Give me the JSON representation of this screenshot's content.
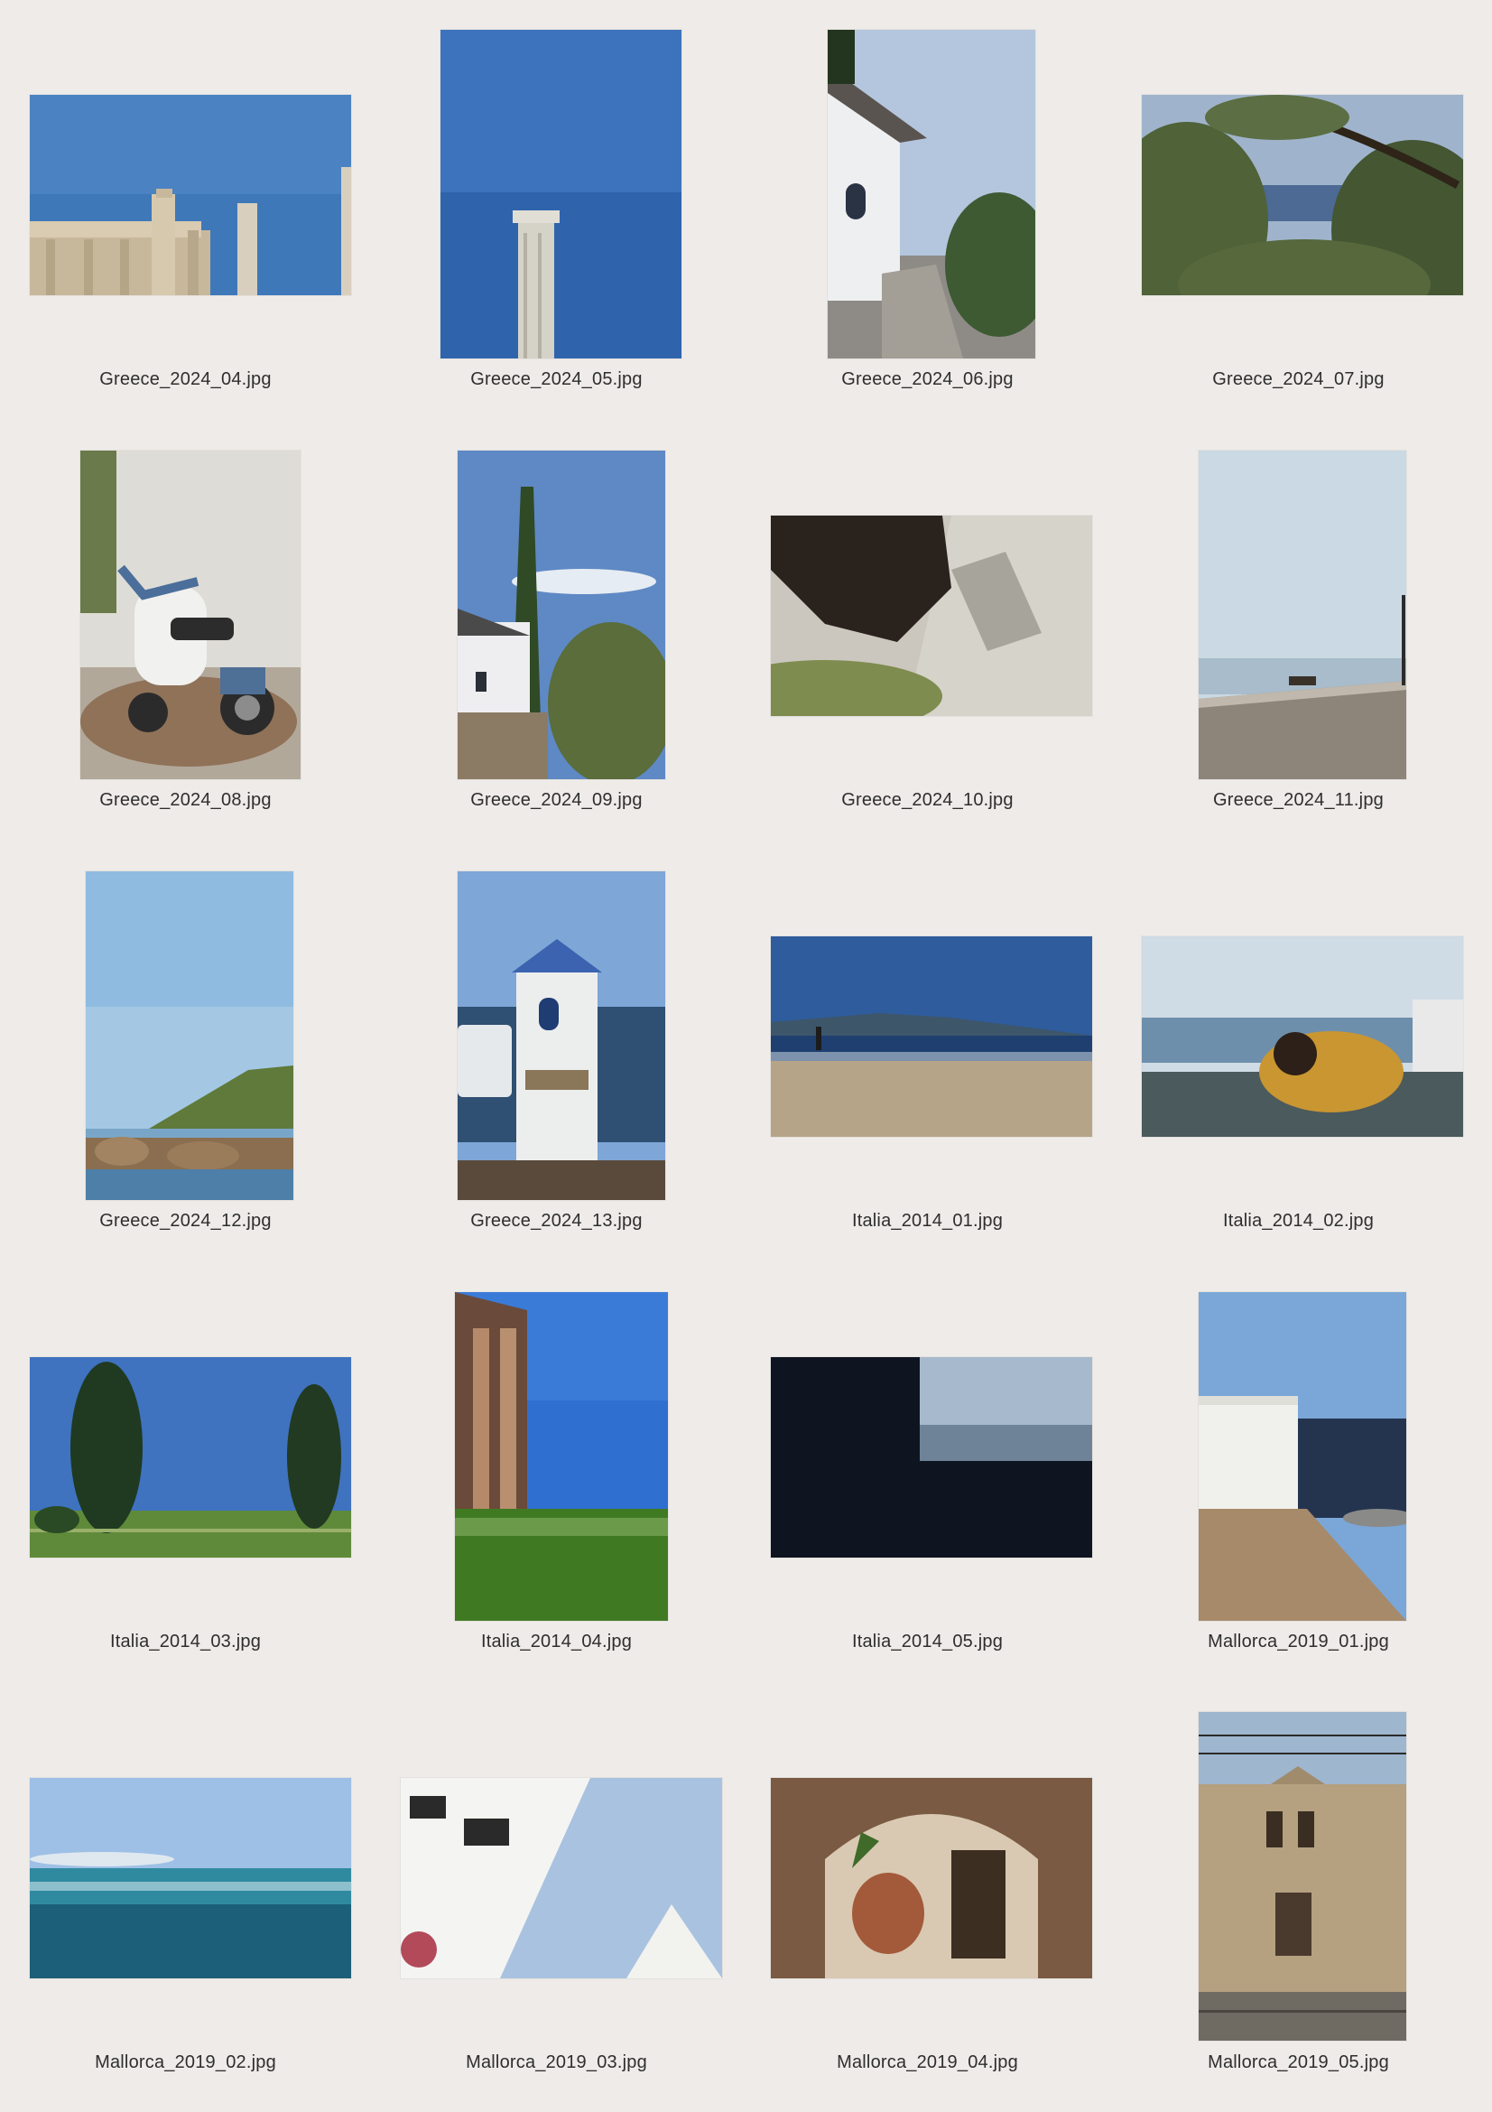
{
  "photos": [
    {
      "label": "Greece_2024_04.jpg",
      "icon": "ruins-columns-photo",
      "palette": [
        "#4f86c4",
        "#2f6cb5",
        "#d8cbb3",
        "#b8a98c"
      ]
    },
    {
      "label": "Greece_2024_05.jpg",
      "icon": "single-column-photo",
      "palette": [
        "#3e73bd",
        "#2c5fa8",
        "#d9d6cc",
        "#b9b4a7"
      ]
    },
    {
      "label": "Greece_2024_06.jpg",
      "icon": "white-chapel-photo",
      "palette": [
        "#a9bfdc",
        "#eef0f2",
        "#8c8a86",
        "#3f5c36"
      ]
    },
    {
      "label": "Greece_2024_07.jpg",
      "icon": "olive-trees-sea-photo",
      "palette": [
        "#a7b9cf",
        "#4a678f",
        "#485a36",
        "#2e3a22"
      ]
    },
    {
      "label": "Greece_2024_08.jpg",
      "icon": "scooter-photo",
      "palette": [
        "#e4e3de",
        "#c9c6bf",
        "#4a6d96",
        "#8a6f55"
      ]
    },
    {
      "label": "Greece_2024_09.jpg",
      "icon": "cypress-house-photo",
      "palette": [
        "#5d89c4",
        "#e9e9ec",
        "#2d4a22",
        "#8a7a64"
      ]
    },
    {
      "label": "Greece_2024_10.jpg",
      "icon": "foot-shadow-photo",
      "palette": [
        "#c9c5bc",
        "#2b2520",
        "#7a8a4c",
        "#a9a59c"
      ]
    },
    {
      "label": "Greece_2024_11.jpg",
      "icon": "bench-seafront-photo",
      "palette": [
        "#c8d8e2",
        "#9fb6c8",
        "#8c8378",
        "#2b2b2b"
      ]
    },
    {
      "label": "Greece_2024_12.jpg",
      "icon": "bay-hill-photo",
      "palette": [
        "#9ec3e2",
        "#6fa2d0",
        "#5f7a3a",
        "#8a6e4f"
      ]
    },
    {
      "label": "Greece_2024_13.jpg",
      "icon": "roadside-shrine-photo",
      "palette": [
        "#7ea6d6",
        "#f0f0ef",
        "#2f4f73",
        "#5a4a3c"
      ]
    },
    {
      "label": "Italia_2014_01.jpg",
      "icon": "beach-walker-photo",
      "palette": [
        "#345f9d",
        "#1f3f71",
        "#b8a58a",
        "#9b8a72"
      ]
    },
    {
      "label": "Italia_2014_02.jpg",
      "icon": "harbor-view-photo",
      "palette": [
        "#cdd9e4",
        "#6d8fac",
        "#c9922e",
        "#4b5a5c"
      ]
    },
    {
      "label": "Italia_2014_03.jpg",
      "icon": "twin-cypress-photo",
      "palette": [
        "#3f72bf",
        "#1f3a21",
        "#5f8a3a",
        "#98b06a"
      ]
    },
    {
      "label": "Italia_2014_04.jpg",
      "icon": "temple-columns-photo",
      "palette": [
        "#2f6fd0",
        "#b58a6a",
        "#3f7a22",
        "#6a4a3a"
      ]
    },
    {
      "label": "Italia_2014_05.jpg",
      "icon": "window-sea-photo",
      "palette": [
        "#0e1520",
        "#a7b9cc",
        "#6e8398",
        "#24354a"
      ]
    },
    {
      "label": "Mallorca_2019_01.jpg",
      "icon": "white-wall-sea-photo",
      "palette": [
        "#79a6d6",
        "#f0f0ec",
        "#24344f",
        "#a68a6a"
      ]
    },
    {
      "label": "Mallorca_2019_02.jpg",
      "icon": "open-sea-photo",
      "palette": [
        "#9ec0e6",
        "#2f8aa0",
        "#1c5f78",
        "#dfe8ef"
      ]
    },
    {
      "label": "Mallorca_2019_03.jpg",
      "icon": "white-building-angle-photo",
      "palette": [
        "#a9c2e0",
        "#f4f4f2",
        "#2a2a2a",
        "#cfd4da"
      ]
    },
    {
      "label": "Mallorca_2019_04.jpg",
      "icon": "courtyard-amphora-photo",
      "palette": [
        "#7a5a42",
        "#d9c9b2",
        "#3d2e22",
        "#a35a3a"
      ]
    },
    {
      "label": "Mallorca_2019_05.jpg",
      "icon": "station-building-photo",
      "palette": [
        "#9fb6cf",
        "#b5a080",
        "#5a4a3a",
        "#6f6a62"
      ]
    }
  ]
}
